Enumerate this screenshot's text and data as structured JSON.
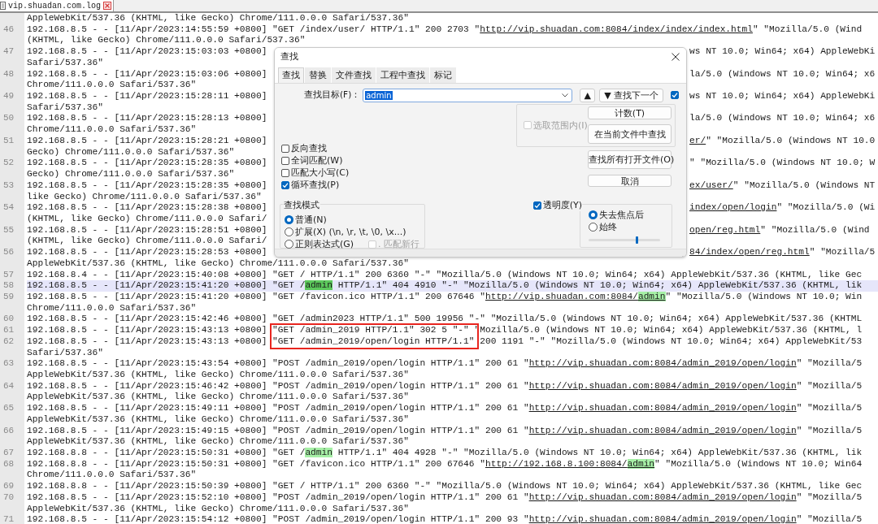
{
  "file_tab": {
    "label": "vip.shuadan.com.log",
    "selected": true
  },
  "rows": [
    {
      "current": false,
      "segments": [
        {
          "kind": "text",
          "text": "AppleWebKit/537.36 (KHTML, like Gecko) Chrome/111.0.0.0 Safari/537.36\""
        }
      ]
    },
    {
      "number": "46",
      "current": false,
      "segments": [
        {
          "kind": "text",
          "text": "192.168.8.5 - - [11/Apr/2023:14:55:59 +0800] \"GET /index/user/ HTTP/1.1\" 200 2703 \""
        },
        {
          "kind": "link",
          "text": "http://vip.shuadan.com:8084/index/index/index.html"
        },
        {
          "kind": "text",
          "text": "\" \"Mozilla/5.0 (Wind"
        }
      ]
    },
    {
      "current": false,
      "segments": [
        {
          "kind": "text",
          "text": "(KHTML, like Gecko) Chrome/111.0.0.0 Safari/537.36\""
        }
      ]
    },
    {
      "number": "47",
      "current": false,
      "segments": [
        {
          "kind": "text",
          "text": "192.168.8.5 - - [11/Apr/2023:15:03:03 +0800]"
        }
      ],
      "right_segments": [
        {
          "kind": "text",
          "text": "ws NT 10.0; Win64; x64) AppleWebKi"
        }
      ]
    },
    {
      "current": false,
      "segments": [
        {
          "kind": "text",
          "text": "Safari/537.36\""
        }
      ]
    },
    {
      "number": "48",
      "current": false,
      "segments": [
        {
          "kind": "text",
          "text": "192.168.8.5 - - [11/Apr/2023:15:03:06 +0800]"
        }
      ],
      "right_segments": [
        {
          "kind": "text",
          "text": "la/5.0 (Windows NT 10.0; Win64; x6"
        }
      ]
    },
    {
      "current": false,
      "segments": [
        {
          "kind": "text",
          "text": "Chrome/111.0.0.0 Safari/537.36\""
        }
      ]
    },
    {
      "number": "49",
      "current": false,
      "segments": [
        {
          "kind": "text",
          "text": "192.168.8.5 - - [11/Apr/2023:15:28:11 +0800]"
        }
      ],
      "right_segments": [
        {
          "kind": "text",
          "text": "ws NT 10.0; Win64; x64) AppleWebKi"
        }
      ]
    },
    {
      "current": false,
      "segments": [
        {
          "kind": "text",
          "text": "Safari/537.36\""
        }
      ]
    },
    {
      "number": "50",
      "current": false,
      "segments": [
        {
          "kind": "text",
          "text": "192.168.8.5 - - [11/Apr/2023:15:28:13 +0800]"
        }
      ],
      "right_segments": [
        {
          "kind": "text",
          "text": "la/5.0 (Windows NT 10.0; Win64; x6"
        }
      ]
    },
    {
      "current": false,
      "segments": [
        {
          "kind": "text",
          "text": "Chrome/111.0.0.0 Safari/537.36\""
        }
      ]
    },
    {
      "number": "51",
      "current": false,
      "segments": [
        {
          "kind": "text",
          "text": "192.168.8.5 - - [11/Apr/2023:15:28:21 +0800]"
        }
      ],
      "right_segments": [
        {
          "kind": "link",
          "text": "er/"
        },
        {
          "kind": "text",
          "text": "\" \"Mozilla/5.0 (Windows NT 10.0"
        }
      ]
    },
    {
      "current": false,
      "segments": [
        {
          "kind": "text",
          "text": "Gecko) Chrome/111.0.0.0 Safari/537.36\""
        }
      ]
    },
    {
      "number": "52",
      "current": false,
      "segments": [
        {
          "kind": "text",
          "text": "192.168.8.5 - - [11/Apr/2023:15:28:35 +0800]"
        }
      ],
      "right_segments": [
        {
          "kind": "text",
          "text": "\" \"Mozilla/5.0 (Windows NT 10.0; W"
        }
      ]
    },
    {
      "current": false,
      "segments": [
        {
          "kind": "text",
          "text": "Gecko) Chrome/111.0.0.0 Safari/537.36\""
        }
      ]
    },
    {
      "number": "53",
      "current": false,
      "segments": [
        {
          "kind": "text",
          "text": "192.168.8.5 - - [11/Apr/2023:15:28:35 +0800]"
        }
      ],
      "right_segments": [
        {
          "kind": "link",
          "text": "ex/user/"
        },
        {
          "kind": "text",
          "text": "\" \"Mozilla/5.0 (Windows NT"
        }
      ]
    },
    {
      "current": false,
      "segments": [
        {
          "kind": "text",
          "text": "like Gecko) Chrome/111.0.0.0 Safari/537.36\""
        }
      ]
    },
    {
      "number": "54",
      "current": false,
      "segments": [
        {
          "kind": "text",
          "text": "192.168.8.5 - - [11/Apr/2023:15:28:38 +0800]"
        }
      ],
      "right_segments": [
        {
          "kind": "link",
          "text": "index/open/login"
        },
        {
          "kind": "text",
          "text": "\" \"Mozilla/5.0 (Wi"
        }
      ]
    },
    {
      "current": false,
      "segments": [
        {
          "kind": "text",
          "text": "(KHTML, like Gecko) Chrome/111.0.0.0 Safari/"
        }
      ]
    },
    {
      "number": "55",
      "current": false,
      "segments": [
        {
          "kind": "text",
          "text": "192.168.8.5 - - [11/Apr/2023:15:28:51 +0800]"
        }
      ],
      "right_segments": [
        {
          "kind": "link",
          "text": "open/reg.html"
        },
        {
          "kind": "text",
          "text": "\" \"Mozilla/5.0 (Wind"
        }
      ]
    },
    {
      "current": false,
      "segments": [
        {
          "kind": "text",
          "text": "(KHTML, like Gecko) Chrome/111.0.0.0 Safari/"
        }
      ]
    },
    {
      "number": "56",
      "current": false,
      "segments": [
        {
          "kind": "text",
          "text": "192.168.8.5 - - [11/Apr/2023:15:28:53 +0800]"
        }
      ],
      "right_segments": [
        {
          "kind": "link",
          "text": "84/index/open/reg.html"
        },
        {
          "kind": "text",
          "text": "\" \"Mozilla/5"
        }
      ]
    },
    {
      "current": false,
      "segments": [
        {
          "kind": "text",
          "text": "AppleWebKit/537.36 (KHTML, like Gecko) Chrome/111.0.0.0 Safari/537.36\""
        }
      ]
    },
    {
      "number": "57",
      "current": false,
      "segments": [
        {
          "kind": "text",
          "text": "192.168.8.4 - - [11/Apr/2023:15:40:08 +0800] \"GET / HTTP/1.1\" 200 6360 \"-\" \"Mozilla/5.0 (Windows NT 10.0; Win64; x64) AppleWebKit/537.36 (KHTML, like Gec"
        }
      ]
    },
    {
      "number": "58",
      "current": true,
      "segments": [
        {
          "kind": "text",
          "text": "192.168.8.5 - - [11/Apr/2023:15:41:20 +0800] \"GET /"
        },
        {
          "kind": "match",
          "text": "admin"
        },
        {
          "kind": "text",
          "text": " HTTP/1.1\" 404 4910 \"-\" \"Mozilla/5.0 (Windows NT 10.0; Win64; x64) AppleWebKit/537.36 (KHTML, lik"
        }
      ]
    },
    {
      "number": "59",
      "current": false,
      "segments": [
        {
          "kind": "text",
          "text": "192.168.8.5 - - [11/Apr/2023:15:41:20 +0800] \"GET /favicon.ico HTTP/1.1\" 200 67646 \""
        },
        {
          "kind": "link",
          "text": "http://vip.shuadan.com:8084/"
        },
        {
          "kind": "link_match",
          "text": "admin"
        },
        {
          "kind": "text",
          "text": "\" \"Mozilla/5.0 (Windows NT 10.0; Win"
        }
      ]
    },
    {
      "current": false,
      "segments": [
        {
          "kind": "text",
          "text": "Chrome/111.0.0.0 Safari/537.36\""
        }
      ]
    },
    {
      "number": "60",
      "current": false,
      "segments": [
        {
          "kind": "text",
          "text": "192.168.8.5 - - [11/Apr/2023:15:42:46 +0800] \"GET /admin2023 HTTP/1.1\" 500 19956 \"-\" \"Mozilla/5.0 (Windows NT 10.0; Win64; x64) AppleWebKit/537.36 (KHTML"
        }
      ]
    },
    {
      "number": "61",
      "current": false,
      "segments": [
        {
          "kind": "text",
          "text": "192.168.8.5 - - [11/Apr/2023:15:43:13 +0800] \"GET /admin_2019 HTTP/1.1\" 302 5 \"-\" \"Mozilla/5.0 (Windows NT 10.0; Win64; x64) AppleWebKit/537.36 (KHTML, l"
        }
      ]
    },
    {
      "number": "62",
      "current": false,
      "segments": [
        {
          "kind": "text",
          "text": "192.168.8.5 - - [11/Apr/2023:15:43:13 +0800] \"GET /admin_2019/open/login HTTP/1.1\" 200 1191 \"-\" \"Mozilla/5.0 (Windows NT 10.0; Win64; x64) AppleWebKit/53"
        }
      ]
    },
    {
      "current": false,
      "segments": [
        {
          "kind": "text",
          "text": "Safari/537.36\""
        }
      ]
    },
    {
      "number": "63",
      "current": false,
      "segments": [
        {
          "kind": "text",
          "text": "192.168.8.5 - - [11/Apr/2023:15:43:54 +0800] \"POST /admin_2019/open/login HTTP/1.1\" 200 61 \""
        },
        {
          "kind": "link",
          "text": "http://vip.shuadan.com:8084/admin_2019/open/login"
        },
        {
          "kind": "text",
          "text": "\" \"Mozilla/5"
        }
      ]
    },
    {
      "current": false,
      "segments": [
        {
          "kind": "text",
          "text": "AppleWebKit/537.36 (KHTML, like Gecko) Chrome/111.0.0.0 Safari/537.36\""
        }
      ]
    },
    {
      "number": "64",
      "current": false,
      "segments": [
        {
          "kind": "text",
          "text": "192.168.8.5 - - [11/Apr/2023:15:46:42 +0800] \"POST /admin_2019/open/login HTTP/1.1\" 200 61 \""
        },
        {
          "kind": "link",
          "text": "http://vip.shuadan.com:8084/admin_2019/open/login"
        },
        {
          "kind": "text",
          "text": "\" \"Mozilla/5"
        }
      ]
    },
    {
      "current": false,
      "segments": [
        {
          "kind": "text",
          "text": "AppleWebKit/537.36 (KHTML, like Gecko) Chrome/111.0.0.0 Safari/537.36\""
        }
      ]
    },
    {
      "number": "65",
      "current": false,
      "segments": [
        {
          "kind": "text",
          "text": "192.168.8.5 - - [11/Apr/2023:15:49:11 +0800] \"POST /admin_2019/open/login HTTP/1.1\" 200 61 \""
        },
        {
          "kind": "link",
          "text": "http://vip.shuadan.com:8084/admin_2019/open/login"
        },
        {
          "kind": "text",
          "text": "\" \"Mozilla/5"
        }
      ]
    },
    {
      "current": false,
      "segments": [
        {
          "kind": "text",
          "text": "AppleWebKit/537.36 (KHTML, like Gecko) Chrome/111.0.0.0 Safari/537.36\""
        }
      ]
    },
    {
      "number": "66",
      "current": false,
      "segments": [
        {
          "kind": "text",
          "text": "192.168.8.5 - - [11/Apr/2023:15:49:15 +0800] \"POST /admin_2019/open/login HTTP/1.1\" 200 61 \""
        },
        {
          "kind": "link",
          "text": "http://vip.shuadan.com:8084/admin_2019/open/login"
        },
        {
          "kind": "text",
          "text": "\" \"Mozilla/5"
        }
      ]
    },
    {
      "current": false,
      "segments": [
        {
          "kind": "text",
          "text": "AppleWebKit/537.36 (KHTML, like Gecko) Chrome/111.0.0.0 Safari/537.36\""
        }
      ]
    },
    {
      "number": "67",
      "current": false,
      "segments": [
        {
          "kind": "text",
          "text": "192.168.8.8 - - [11/Apr/2023:15:50:31 +0800] \"GET /"
        },
        {
          "kind": "match",
          "text": "admin"
        },
        {
          "kind": "text",
          "text": " HTTP/1.1\" 404 4928 \"-\" \"Mozilla/5.0 (Windows NT 10.0; Win64; x64) AppleWebKit/537.36 (KHTML, lik"
        }
      ]
    },
    {
      "number": "68",
      "current": false,
      "segments": [
        {
          "kind": "text",
          "text": "192.168.8.8 - - [11/Apr/2023:15:50:31 +0800] \"GET /favicon.ico HTTP/1.1\" 200 67646 \""
        },
        {
          "kind": "link",
          "text": "http://192.168.8.100:8084/"
        },
        {
          "kind": "link_match",
          "text": "admin"
        },
        {
          "kind": "text",
          "text": "\" \"Mozilla/5.0 (Windows NT 10.0; Win64"
        }
      ]
    },
    {
      "current": false,
      "segments": [
        {
          "kind": "text",
          "text": "Chrome/111.0.0.0 Safari/537.36\""
        }
      ]
    },
    {
      "number": "69",
      "current": false,
      "segments": [
        {
          "kind": "text",
          "text": "192.168.8.8 - - [11/Apr/2023:15:50:39 +0800] \"GET / HTTP/1.1\" 200 6360 \"-\" \"Mozilla/5.0 (Windows NT 10.0; Win64; x64) AppleWebKit/537.36 (KHTML, like Gec"
        }
      ]
    },
    {
      "number": "70",
      "current": false,
      "segments": [
        {
          "kind": "text",
          "text": "192.168.8.5 - - [11/Apr/2023:15:52:10 +0800] \"POST /admin_2019/open/login HTTP/1.1\" 200 61 \""
        },
        {
          "kind": "link",
          "text": "http://vip.shuadan.com:8084/admin_2019/open/login"
        },
        {
          "kind": "text",
          "text": "\" \"Mozilla/5"
        }
      ]
    },
    {
      "current": false,
      "segments": [
        {
          "kind": "text",
          "text": "AppleWebKit/537.36 (KHTML, like Gecko) Chrome/111.0.0.0 Safari/537.36\""
        }
      ]
    },
    {
      "number": "71",
      "current": false,
      "segments": [
        {
          "kind": "text",
          "text": "192.168.8.5 - - [11/Apr/2023:15:54:12 +0800] \"POST /admin_2019/open/login HTTP/1.1\" 200 93 \""
        },
        {
          "kind": "link",
          "text": "http://vip.shuadan.com:8084/admin_2019/open/login"
        },
        {
          "kind": "text",
          "text": "\" \"Mozilla/5"
        }
      ]
    }
  ],
  "find_dialog": {
    "title": "查找",
    "tabs": [
      {
        "label": "查找",
        "selected": true
      },
      {
        "label": "替换",
        "selected": false
      },
      {
        "label": "文件查找",
        "selected": false
      },
      {
        "label": "工程中查找",
        "selected": false
      },
      {
        "label": "标记",
        "selected": false
      }
    ],
    "find_label": "查找目标(F)：",
    "find_value": "admin",
    "up_button": "▲",
    "next_button": "▼ 查找下一个",
    "next_option_checked": true,
    "scope": {
      "label": "选取范围内(I)",
      "checked": false,
      "disabled": true
    },
    "buttons": [
      "计数(T)",
      "在当前文件中查找",
      "查找所有打开文件(O)",
      "取消"
    ],
    "options": [
      {
        "label": "反向查找",
        "checked": false
      },
      {
        "label": "全词匹配(W)",
        "checked": false
      },
      {
        "label": "匹配大小写(C)",
        "checked": false
      },
      {
        "label": "循环查找(P)",
        "checked": true
      }
    ],
    "mode": {
      "title": "查找模式",
      "choices": [
        {
          "label": "普通(N)",
          "selected": true
        },
        {
          "label": "扩展(X) (\\n, \\r, \\t, \\0, \\x...)",
          "selected": false
        },
        {
          "label": "正则表达式(G)",
          "selected": false
        }
      ],
      "newline": {
        "label": ". 匹配新行",
        "checked": false,
        "disabled": true
      }
    },
    "transparency": {
      "label": "透明度(Y)",
      "checked": true,
      "choices": [
        {
          "label": "失去焦点后",
          "selected": true
        },
        {
          "label": "始终",
          "selected": false
        }
      ],
      "level": 0.67
    }
  }
}
